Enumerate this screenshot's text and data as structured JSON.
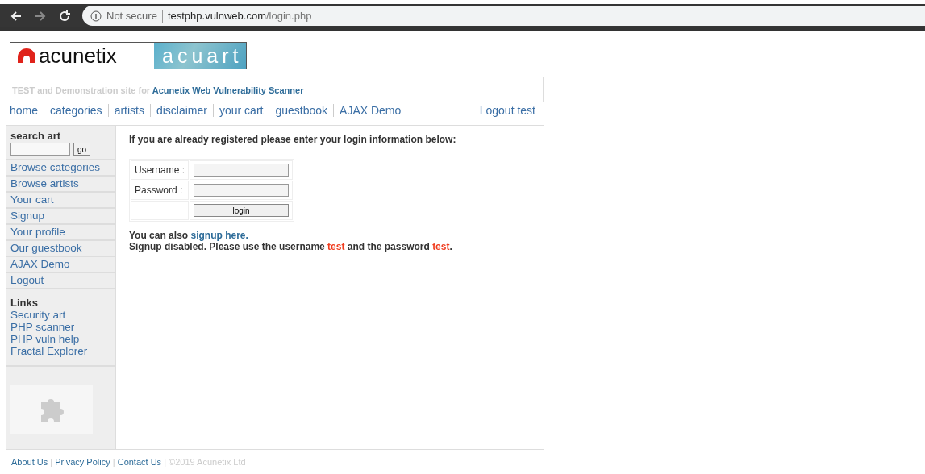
{
  "browser": {
    "security": "Not secure",
    "url_host": "testphp.vulnweb.com",
    "url_path": "/login.php"
  },
  "logo": {
    "brand": "acunetix",
    "product": "acuart"
  },
  "tagline": [
    {
      "kind": "plain",
      "text": "TEST and Demonstration site for "
    },
    {
      "kind": "link",
      "text": "Acunetix Web Vulnerability Scanner"
    }
  ],
  "nav": {
    "items": [
      "home",
      "categories",
      "artists",
      "disclaimer",
      "your cart",
      "guestbook",
      "AJAX Demo"
    ],
    "logout": "Logout test"
  },
  "sidebar": {
    "search_title": "search art",
    "go": "go",
    "items": [
      "Browse categories",
      "Browse artists",
      "Your cart",
      "Signup",
      "Your profile",
      "Our guestbook",
      "AJAX Demo",
      "Logout"
    ],
    "links_title": "Links",
    "links": [
      "Security art",
      "PHP scanner",
      "PHP vuln help",
      "Fractal Explorer"
    ]
  },
  "login": {
    "heading": "If you are already registered please enter your login information below:",
    "fields": [
      {
        "label": "Username :"
      },
      {
        "label": "Password :"
      }
    ],
    "button": "login",
    "also": {
      "text": "You can also ",
      "link": "signup here."
    },
    "notice": [
      {
        "kind": "plain",
        "text": "Signup disabled. Please use the username "
      },
      {
        "kind": "highlight",
        "text": "test"
      },
      {
        "kind": "plain",
        "text": " and the password "
      },
      {
        "kind": "highlight",
        "text": "test"
      },
      {
        "kind": "plain",
        "text": "."
      }
    ]
  },
  "footer": {
    "links": [
      "About Us",
      "Privacy Policy",
      "Contact Us"
    ],
    "separator": "|",
    "copyright": "©2019 Acunetix Ltd"
  }
}
